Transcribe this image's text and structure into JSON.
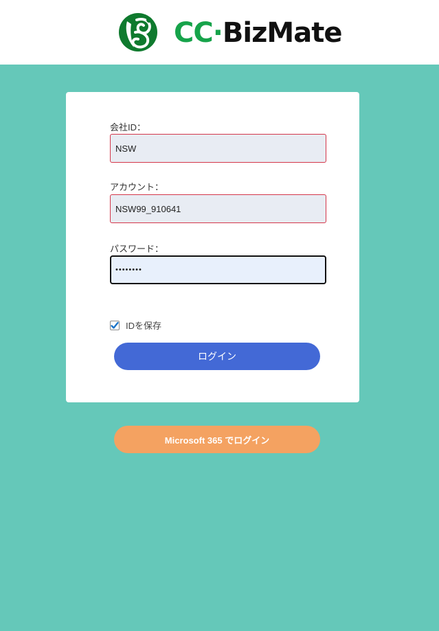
{
  "header": {
    "logo_cc": "CC",
    "logo_dot": "·",
    "logo_biz": "BizMate"
  },
  "form": {
    "company_id": {
      "label": "会社ID：",
      "value": "NSW"
    },
    "account": {
      "label": "アカウント：",
      "value": "NSW99_910641"
    },
    "password": {
      "label": "パスワード：",
      "value": "••••••••"
    },
    "remember": {
      "label": "IDを保存",
      "checked": true
    },
    "login_label": "ログイン"
  },
  "microsoft_login_label": "Microsoft 365 でログイン",
  "colors": {
    "background": "#65c8b9",
    "brand_green": "#16a34a",
    "login_button": "#4369d6",
    "microsoft_button": "#f4a261",
    "error_border": "#d4364a"
  }
}
